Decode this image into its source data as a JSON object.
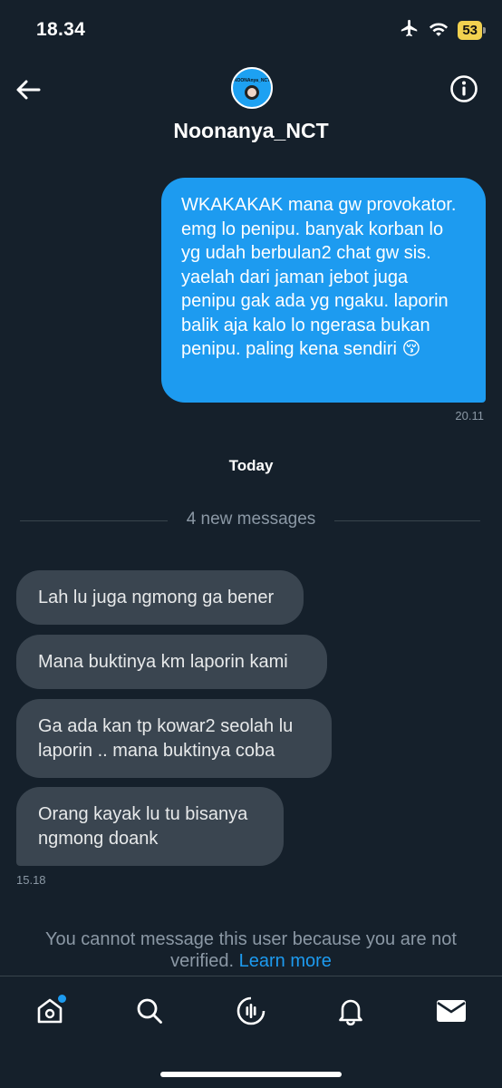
{
  "status_bar": {
    "time": "18.34",
    "battery": "53",
    "icons": [
      "airplane-icon",
      "wifi-icon",
      "battery-icon"
    ]
  },
  "header": {
    "username": "Noonanya_NCT",
    "avatar_text": "NOONAnya_NCT"
  },
  "messages": {
    "outgoing": {
      "text": "WKAKAKAK mana gw provokator. emg lo penipu. banyak korban lo yg udah berbulan2 chat gw sis. yaelah dari jaman jebot juga penipu gak ada yg ngaku. laporin balik aja kalo lo ngerasa bukan penipu. paling kena sendiri 😚",
      "time": "20.11"
    },
    "day_label": "Today",
    "new_messages_label": "4 new messages",
    "incoming": [
      {
        "text": "Lah lu juga ngmong ga bener"
      },
      {
        "text": "Mana buktinya km laporin kami"
      },
      {
        "text": "Ga ada kan tp kowar2 seolah lu laporin .. mana buktinya coba"
      },
      {
        "text": "Orang kayak lu tu bisanya ngmong doank"
      }
    ],
    "incoming_time": "15.18"
  },
  "notice": {
    "text": "You cannot message this user because you are not verified.",
    "link": "Learn more"
  },
  "tabbar": {
    "items": [
      "home-icon",
      "search-icon",
      "spaces-icon",
      "notifications-icon",
      "messages-icon"
    ]
  },
  "colors": {
    "background": "#15202b",
    "accent": "#1d9bf0",
    "incoming_bubble": "#3a4550",
    "muted_text": "#8b98a5"
  }
}
